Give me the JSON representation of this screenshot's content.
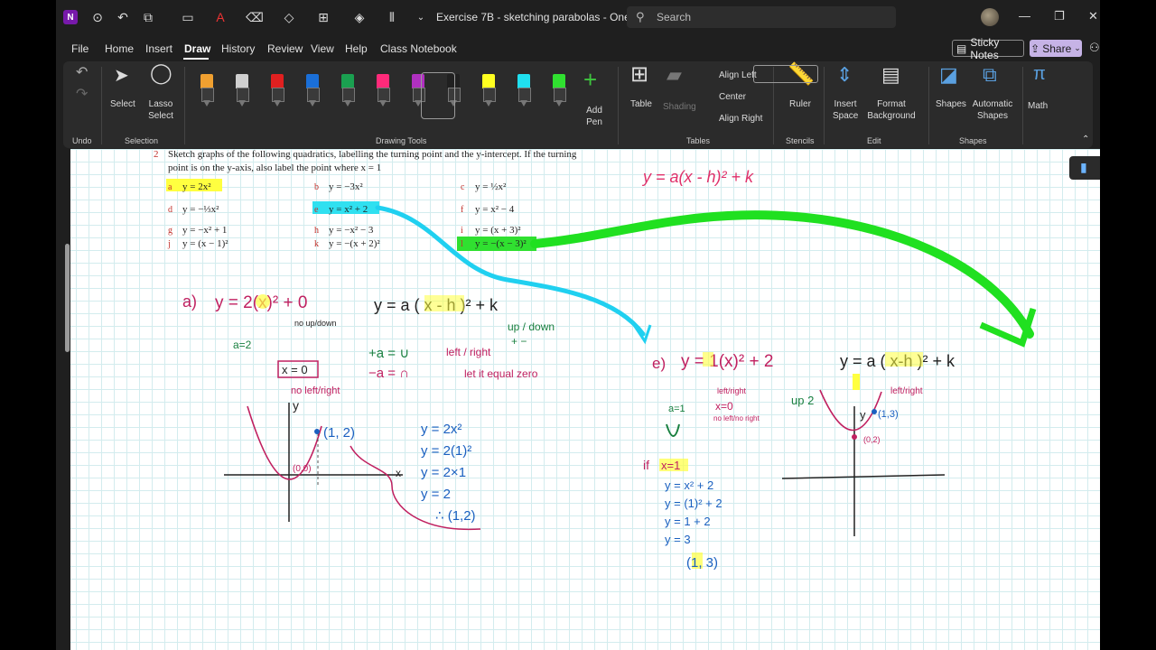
{
  "titlebar": {
    "title": "Exercise 7B - sketching parabolas  -  One...",
    "search_placeholder": "Search"
  },
  "menu": {
    "items": [
      "File",
      "Home",
      "Insert",
      "Draw",
      "History",
      "Review",
      "View",
      "Help",
      "Class Notebook"
    ],
    "active": "Draw",
    "sticky_notes": "Sticky Notes",
    "share": "Share"
  },
  "ribbon": {
    "undo_label": "Undo",
    "selection": {
      "select": "Select",
      "lasso": "Lasso Select",
      "group": "Selection"
    },
    "drawing_tools_group": "Drawing Tools",
    "add_pen": "Add Pen",
    "pen_colors": [
      "#f0a030",
      "#d0d0d0",
      "#e02020",
      "#1a6fd8",
      "#1aa050",
      "#ff2a7a",
      "#b030c0",
      "#202020",
      "#ffff20",
      "#20e0f0",
      "#30e030"
    ],
    "table": "Table",
    "shading": "Shading",
    "align_left": "Align Left",
    "center": "Center",
    "align_right": "Align Right",
    "tables_group": "Tables",
    "ruler": "Ruler",
    "stencils_group": "Stencils",
    "insert_space": "Insert Space",
    "format_background": "Format Background",
    "edit_group": "Edit",
    "shapes": "Shapes",
    "automatic_shapes": "Automatic Shapes",
    "shapes_group": "Shapes",
    "math": "Math"
  },
  "page": {
    "question_number": "2",
    "question_line1": "Sketch graphs of the following quadratics, labelling the turning point and the y-intercept. If the turning",
    "question_line2": "point is on the y-axis, also label the point where x = 1",
    "parts": [
      {
        "l": "a",
        "e": "y = 2x²"
      },
      {
        "l": "b",
        "e": "y = −3x²"
      },
      {
        "l": "c",
        "e": "y = ½x²"
      },
      {
        "l": "d",
        "e": "y = −⅓x²"
      },
      {
        "l": "e",
        "e": "y = x² + 2"
      },
      {
        "l": "f",
        "e": "y = x² − 4"
      },
      {
        "l": "g",
        "e": "y = −x² + 1"
      },
      {
        "l": "h",
        "e": "y = −x² − 3"
      },
      {
        "l": "i",
        "e": "y = (x + 3)²"
      },
      {
        "l": "j",
        "e": "y = (x − 1)²"
      },
      {
        "l": "k",
        "e": "y = −(x + 2)²"
      },
      {
        "l": "l",
        "e": "y = −(x − 3)²"
      }
    ]
  },
  "ink": {
    "top_formula": "y = a(x - h)² + k",
    "a_label": "a)",
    "a_eq": "y = 2(x)² + 0",
    "no_updown": "no up/down",
    "a_eq2": "a=2",
    "x0": "x = 0",
    "no_leftright": "no left/right",
    "general": "y = a ( x - h )² + k",
    "up_down": "up / down",
    "plus_minus": "+   −",
    "pos_a": "+a = ∪",
    "neg_a": "−a = ∩",
    "left_right": "left / right",
    "let_zero": "let it equal zero",
    "work": [
      "y = 2x²",
      "y = 2(1)²",
      "y = 2×1",
      "y = 2",
      "∴ (1,2)"
    ],
    "point_a": "(1, 2)",
    "origin": "(0,0)",
    "axis_y": "y",
    "axis_x": "x",
    "e_label": "e)",
    "e_eq": "y = 1(x)² + 2",
    "e_lr": "left/right",
    "e_x0": "x=0",
    "e_nolr": "no left/no right",
    "e_up2": "up 2",
    "e_a1": "a=1",
    "e_if": "if",
    "e_x1": "x=1",
    "e_work": [
      "y = x² + 2",
      "y = (1)² + 2",
      "y = 1 + 2",
      "y = 3"
    ],
    "e_point": "(1, 3)",
    "l_eq": "y = a ( x-h )² + k",
    "l_lr": "left/right",
    "l_pt1": "(1,3)",
    "l_pt2": "(0,2)",
    "l_y": "y"
  }
}
